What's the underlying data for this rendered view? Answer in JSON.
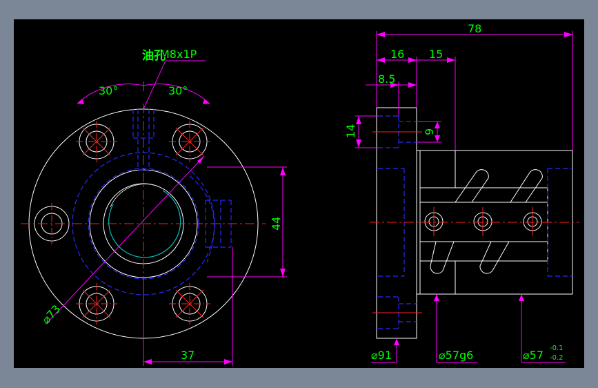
{
  "drawing": {
    "colors": {
      "background": "#000000",
      "frame": "#7b8797",
      "outline": "#ffffff",
      "center_line": "#ff2020",
      "hidden_line": "#2a2aff",
      "dimension_line": "#ff00ff",
      "dimension_text": "#00ff00",
      "thread_line": "#00c0c0"
    },
    "front_view": {
      "oil_hole_label": "油孔",
      "thread_label": "M8x1P",
      "angle_left": "30°",
      "angle_right": "30°",
      "dim_height": "44",
      "dim_pcd": "⌀73",
      "dim_width": "37"
    },
    "side_view": {
      "dim_total": "78",
      "dim_flange": "16",
      "dim_body": "15",
      "dim_half": "8.5",
      "dim_counterbore_outer": "14",
      "dim_counterbore_inner": "9",
      "dim_flange_dia": "⌀91",
      "dim_fit_dia": "⌀57g6",
      "dim_body_dia": "⌀57",
      "tol_upper": "-0.1",
      "tol_lower": "-0.2"
    }
  }
}
